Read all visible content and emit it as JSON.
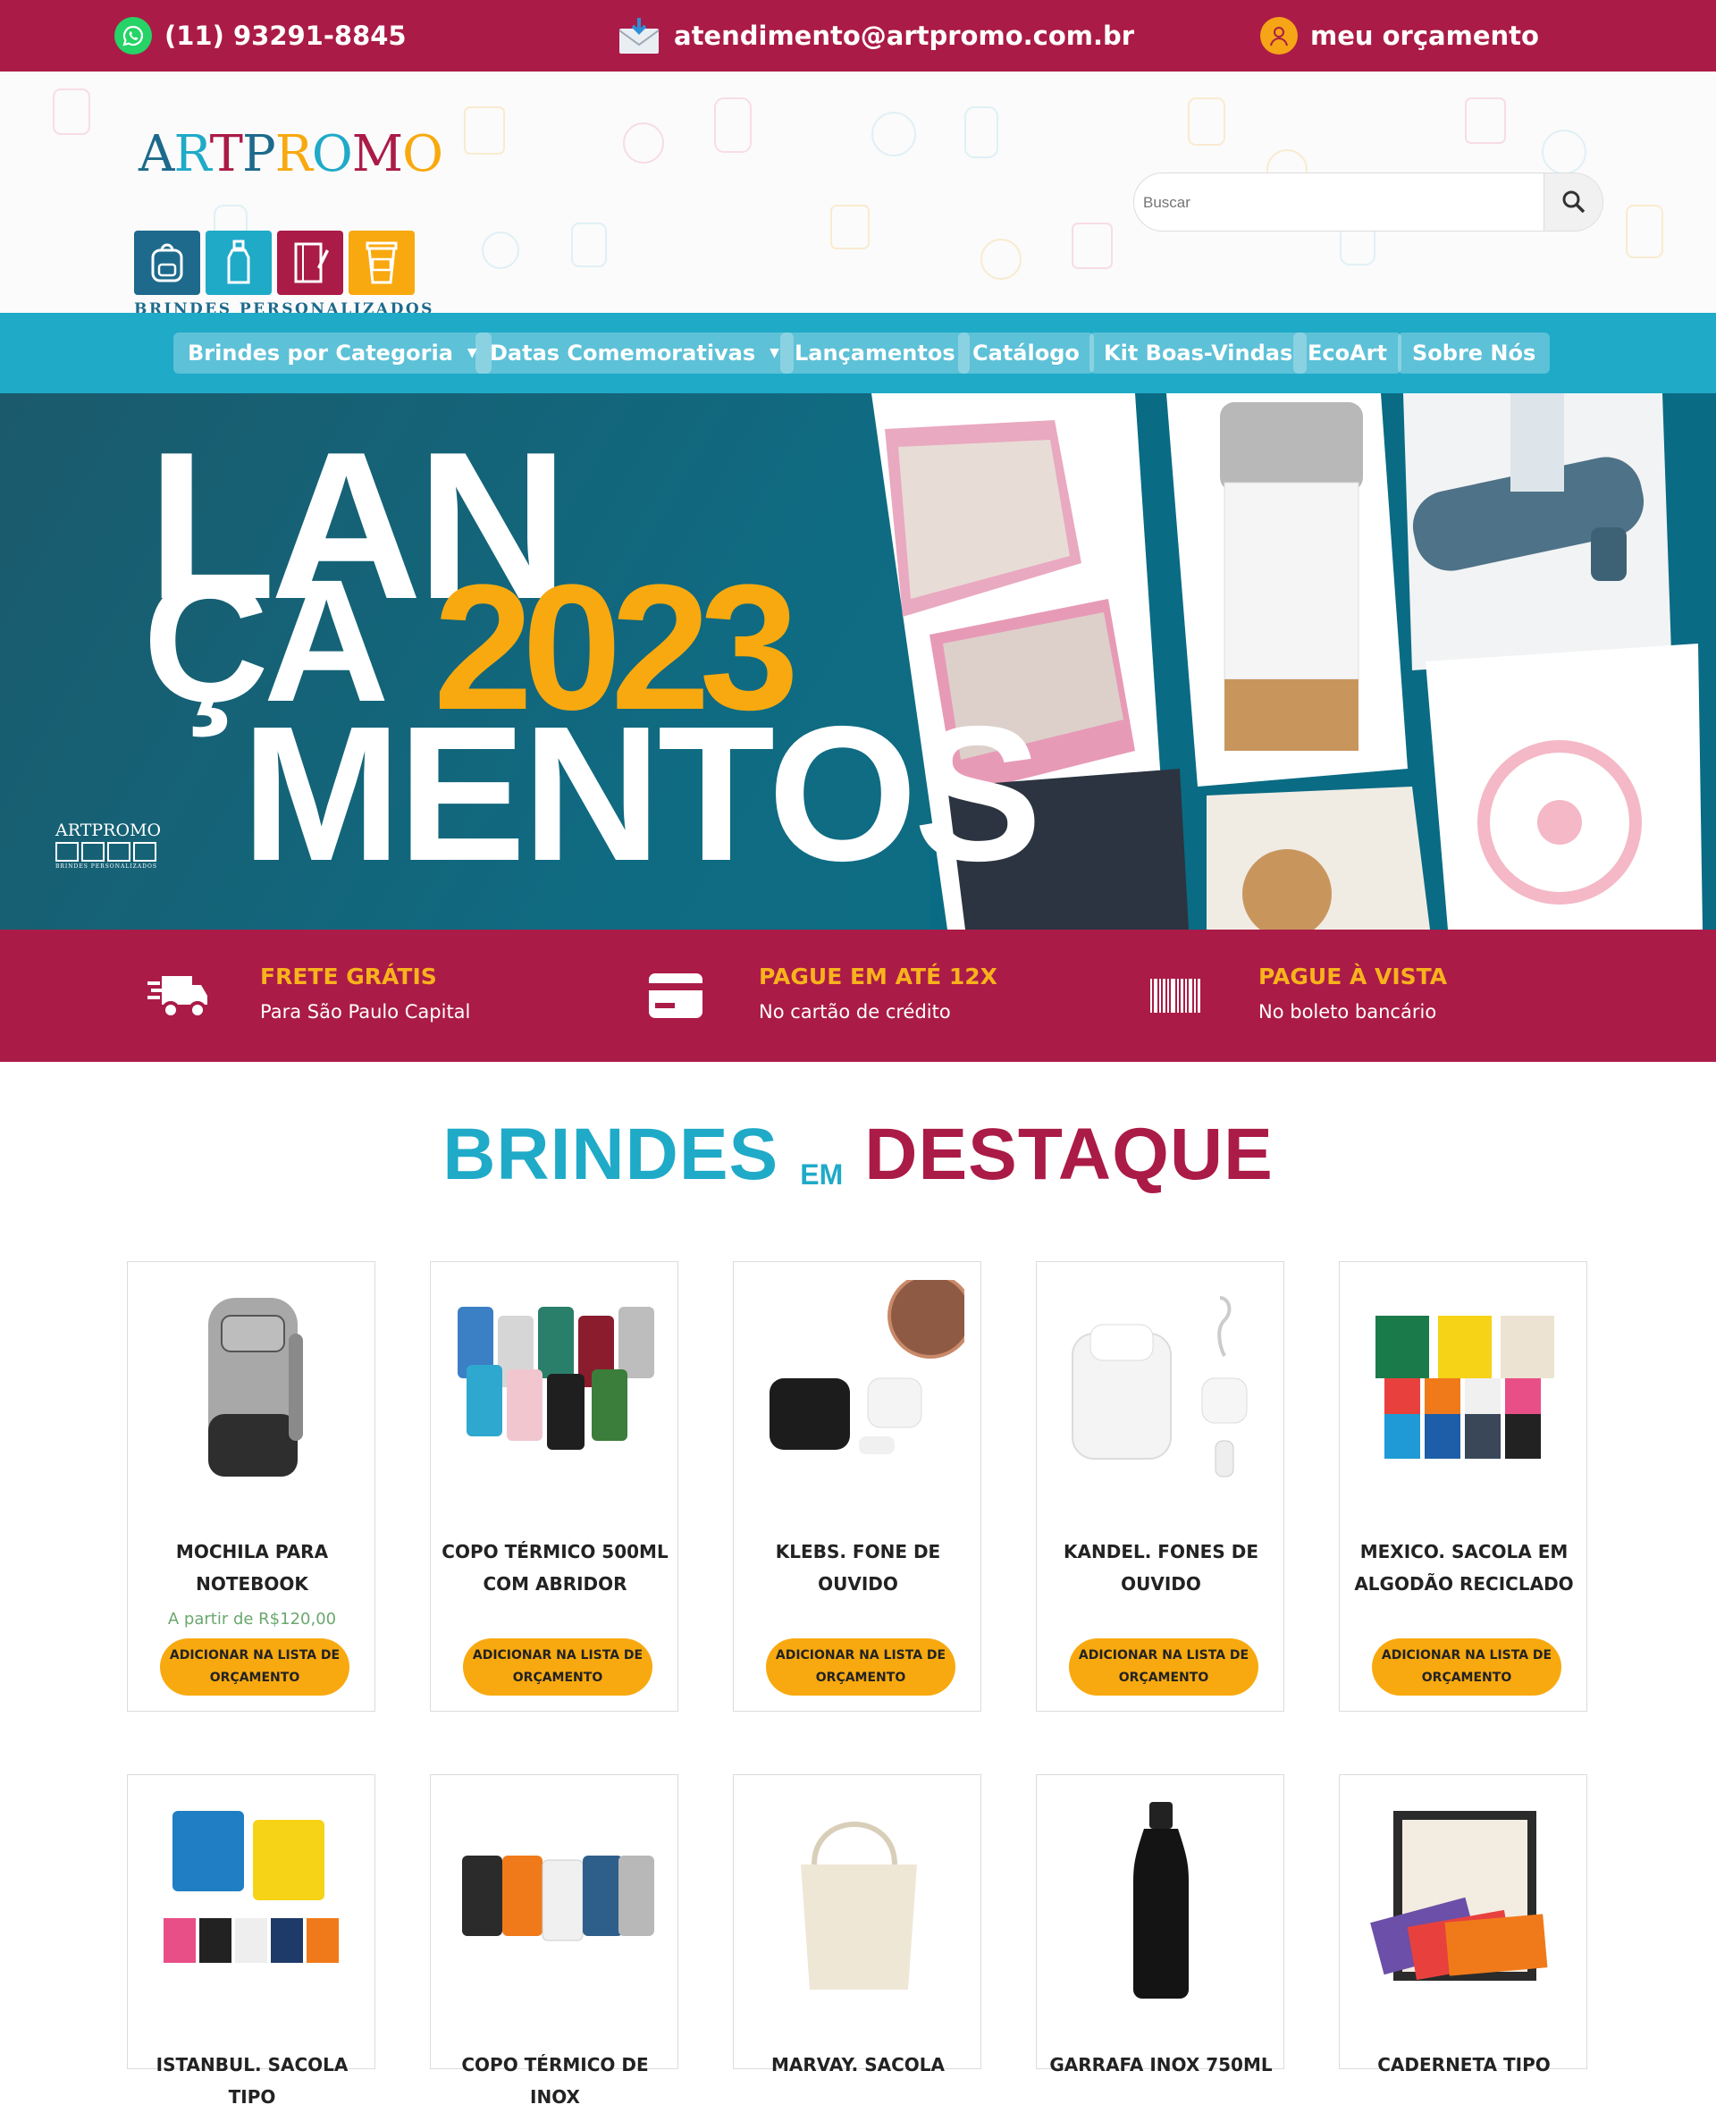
{
  "topbar": {
    "phone": "(11) 93291-8845",
    "email": "atendimento@artpromo.com.br",
    "quote": "meu orçamento"
  },
  "header": {
    "logo_word": "ARTPROMO",
    "logo_tagline": "BRINDES PERSONALIZADOS",
    "search_placeholder": "Buscar"
  },
  "nav": {
    "items": [
      {
        "label": "Brindes por Categoria",
        "has_caret": true
      },
      {
        "label": "Datas Comemorativas",
        "has_caret": true
      },
      {
        "label": "Lançamentos",
        "has_caret": false
      },
      {
        "label": "Catálogo",
        "has_caret": false
      },
      {
        "label": "Kit Boas-Vindas",
        "has_caret": false
      },
      {
        "label": "EcoArt",
        "has_caret": false
      },
      {
        "label": "Sobre Nós",
        "has_caret": false
      }
    ]
  },
  "banner": {
    "line1": "LAN",
    "line2": "ÇA",
    "year": "2023",
    "line3": "MENTOS",
    "logo_word": "ARTPROMO",
    "logo_tagline": "BRINDES PERSONALIZADOS"
  },
  "benefits": [
    {
      "title": "FRETE GRÁTIS",
      "subtitle": "Para São Paulo Capital",
      "icon": "truck-icon"
    },
    {
      "title": "PAGUE EM ATÉ 12X",
      "subtitle": "No cartão de crédito",
      "icon": "credit-card-icon"
    },
    {
      "title": "PAGUE À VISTA",
      "subtitle": "No boleto bancário",
      "icon": "barcode-icon"
    }
  ],
  "section": {
    "word1": "BRINDES",
    "word2": "EM",
    "word3": "DESTAQUE"
  },
  "products": [
    {
      "name": "MOCHILA PARA NOTEBOOK",
      "price": "A partir de R$120,00",
      "button": "ADICIONAR NA LISTA DE ORÇAMENTO"
    },
    {
      "name": "COPO TÉRMICO 500ML COM ABRIDOR",
      "price": "",
      "button": "ADICIONAR NA LISTA DE ORÇAMENTO"
    },
    {
      "name": "KLEBS. FONE DE OUVIDO",
      "price": "",
      "button": "ADICIONAR NA LISTA DE ORÇAMENTO"
    },
    {
      "name": "KANDEL. FONES DE OUVIDO",
      "price": "",
      "button": "ADICIONAR NA LISTA DE ORÇAMENTO"
    },
    {
      "name": "MEXICO. SACOLA EM ALGODÃO RECICLADO",
      "price": "",
      "button": "ADICIONAR NA LISTA DE ORÇAMENTO"
    },
    {
      "name": "ISTANBUL. SACOLA TIPO",
      "price": "",
      "button": ""
    },
    {
      "name": "COPO TÉRMICO DE INOX",
      "price": "",
      "button": ""
    },
    {
      "name": "MARVAY. SACOLA",
      "price": "",
      "button": ""
    },
    {
      "name": "GARRAFA INOX 750ML",
      "price": "",
      "button": ""
    },
    {
      "name": "CADERNETA TIPO",
      "price": "",
      "button": ""
    }
  ],
  "colors": {
    "brand_red": "#ab1b47",
    "nav_blue": "#1faac8",
    "accent_orange": "#f8a90f",
    "price_green": "#6aa86e"
  }
}
